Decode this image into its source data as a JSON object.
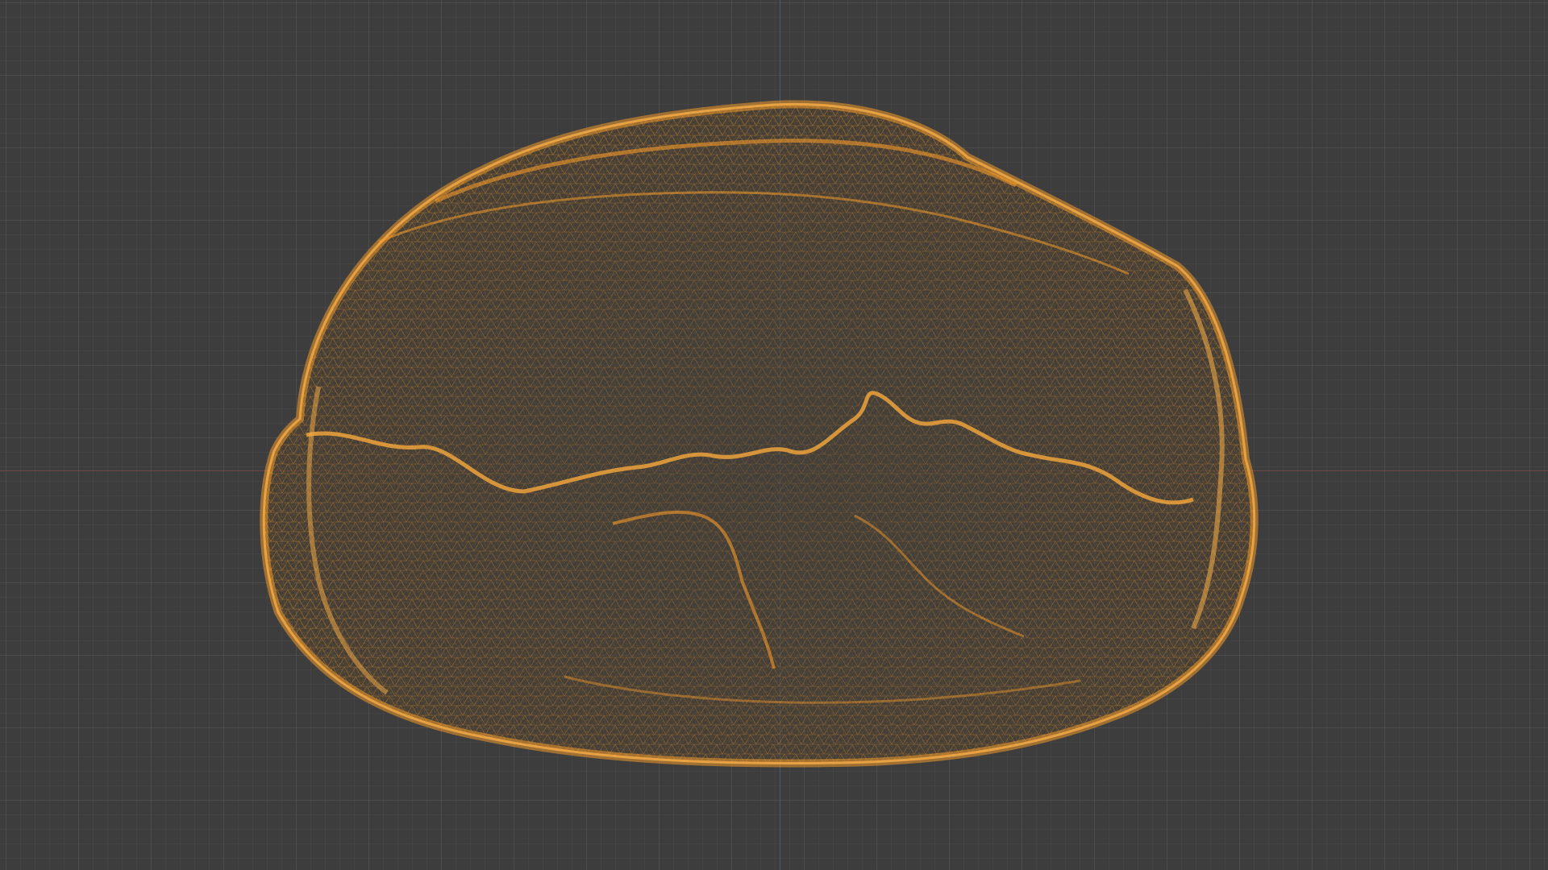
{
  "viewport": {
    "name": "3d-viewport",
    "view": "wireframe"
  },
  "object": {
    "name": "scanned-rock-mesh",
    "display": "wireframe",
    "wire_color": "#f39a2a",
    "background_color": "#3d3d3d"
  },
  "axes": {
    "x_color": "#7a4a4a",
    "y_color": "#4b5f7d"
  }
}
